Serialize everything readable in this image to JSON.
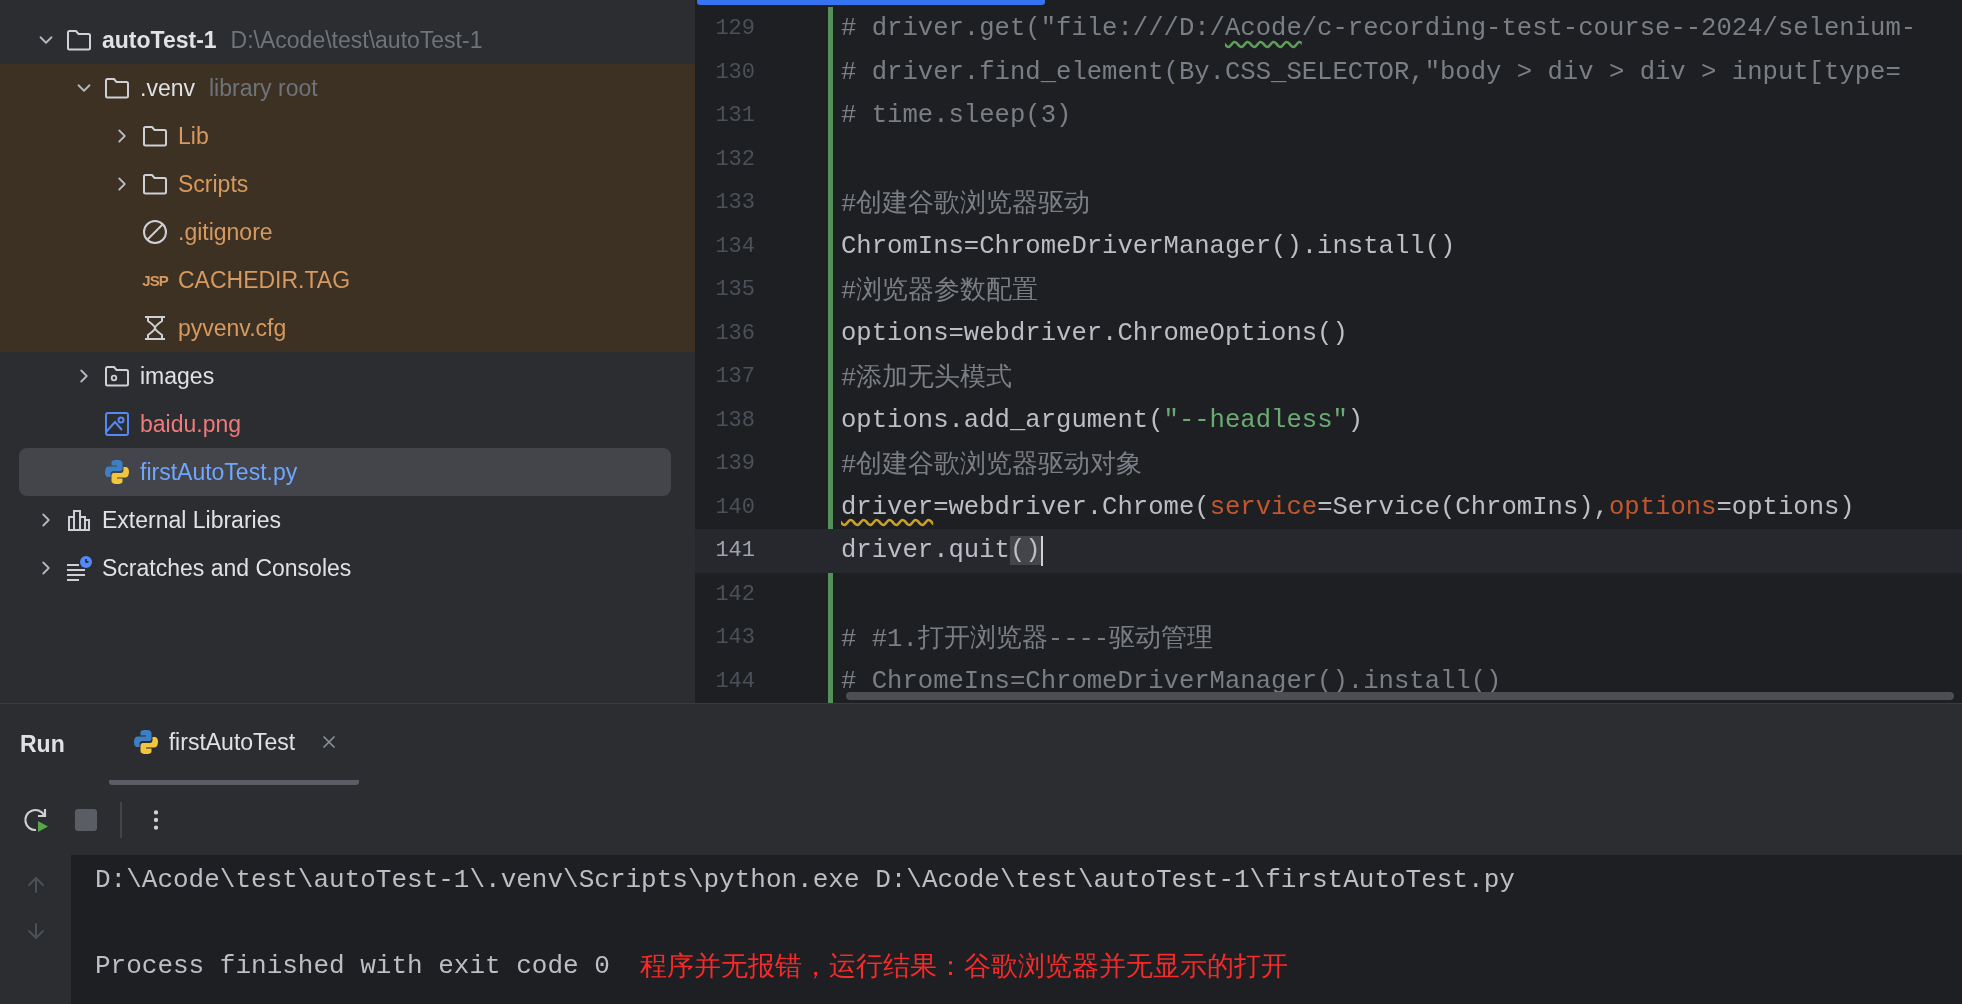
{
  "tree": [
    {
      "name": "autoTest-1",
      "hint": "D:\\Acode\\test\\autoTest-1",
      "kind": "project",
      "expanded": true,
      "selected": false,
      "children": [
        {
          "name": ".venv",
          "hint": "library root",
          "kind": "folder",
          "expanded": true,
          "excluded": true,
          "selected": false,
          "children": [
            {
              "name": "Lib",
              "kind": "folder",
              "expanded": false,
              "selected": false,
              "color": "#d6995f"
            },
            {
              "name": "Scripts",
              "kind": "folder",
              "expanded": false,
              "selected": false,
              "color": "#d6995f"
            },
            {
              "name": ".gitignore",
              "kind": "ignore",
              "selected": false,
              "color": "#d6995f"
            },
            {
              "name": "CACHEDIR.TAG",
              "kind": "tagfile",
              "icon_label": "JSP",
              "selected": false,
              "color": "#d6995f"
            },
            {
              "name": "pyvenv.cfg",
              "kind": "config",
              "selected": false,
              "color": "#d6995f"
            }
          ]
        },
        {
          "name": "images",
          "kind": "resources",
          "expanded": false,
          "selected": false
        },
        {
          "name": "baidu.png",
          "kind": "image",
          "selected": false,
          "color": "#f07a7a"
        },
        {
          "name": "firstAutoTest.py",
          "kind": "python",
          "selected": true,
          "color": "#6fa6ff"
        }
      ]
    },
    {
      "name": "External Libraries",
      "kind": "libraries",
      "expanded": false,
      "selected": false
    },
    {
      "name": "Scratches and Consoles",
      "kind": "scratches",
      "expanded": false,
      "selected": false
    }
  ],
  "editor": {
    "lines": [
      {
        "number": "129",
        "changed": true,
        "current": false,
        "tokens": [
          {
            "kind": "comment",
            "text": "# driver.get(\"file:///D:/"
          },
          {
            "kind": "comment",
            "text": "Acode",
            "typo": true
          },
          {
            "kind": "comment",
            "text": "/c-recording-test-course--2024/selenium-"
          }
        ]
      },
      {
        "number": "130",
        "changed": true,
        "current": false,
        "tokens": [
          {
            "kind": "comment",
            "text": "# driver.find_element(By.CSS_SELECTOR,\"body > div > div > input[type="
          }
        ]
      },
      {
        "number": "131",
        "changed": true,
        "current": false,
        "tokens": [
          {
            "kind": "comment",
            "text": "# time.sleep(3)"
          }
        ]
      },
      {
        "number": "132",
        "changed": true,
        "current": false
      },
      {
        "number": "133",
        "changed": true,
        "current": false,
        "tokens": [
          {
            "kind": "comment",
            "text": "#创建谷歌浏览器驱动"
          }
        ]
      },
      {
        "number": "134",
        "changed": true,
        "current": false,
        "tokens": [
          {
            "kind": "plain",
            "text": "ChromIns=ChromeDriverManager().install()"
          }
        ]
      },
      {
        "number": "135",
        "changed": true,
        "current": false,
        "tokens": [
          {
            "kind": "comment",
            "text": "#浏览器参数配置"
          }
        ]
      },
      {
        "number": "136",
        "changed": true,
        "current": false,
        "tokens": [
          {
            "kind": "plain",
            "text": "options=webdriver.ChromeOptions()"
          }
        ]
      },
      {
        "number": "137",
        "changed": true,
        "current": false,
        "tokens": [
          {
            "kind": "comment",
            "text": "#添加无头模式"
          }
        ]
      },
      {
        "number": "138",
        "changed": true,
        "current": false,
        "tokens": [
          {
            "kind": "plain",
            "text": "options.add_argument("
          },
          {
            "kind": "string",
            "text": "\"--headless\""
          },
          {
            "kind": "plain",
            "text": ")"
          }
        ]
      },
      {
        "number": "139",
        "changed": true,
        "current": false,
        "tokens": [
          {
            "kind": "comment",
            "text": "#创建谷歌浏览器驱动对象"
          }
        ]
      },
      {
        "number": "140",
        "changed": true,
        "current": false,
        "tokens": [
          {
            "kind": "plain",
            "text": "driver",
            "warning": true
          },
          {
            "kind": "plain",
            "text": "=webdriver.Chrome("
          },
          {
            "kind": "param",
            "text": "service"
          },
          {
            "kind": "plain",
            "text": "=Service(ChromIns),"
          },
          {
            "kind": "param",
            "text": "options"
          },
          {
            "kind": "plain",
            "text": "=options)"
          }
        ]
      },
      {
        "number": "141",
        "changed": false,
        "current": true,
        "caret": true,
        "tokens": [
          {
            "kind": "plain",
            "text": "driver.quit"
          },
          {
            "kind": "plain",
            "text": "()",
            "matched": true
          }
        ]
      },
      {
        "number": "142",
        "changed": true,
        "current": false
      },
      {
        "number": "143",
        "changed": true,
        "current": false,
        "tokens": [
          {
            "kind": "comment",
            "text": "# #1.打开浏览器----驱动管理"
          }
        ]
      },
      {
        "number": "144",
        "changed": true,
        "current": false,
        "tokens": [
          {
            "kind": "comment",
            "text": "# ChromeIns=ChromeDriverManager().install()"
          }
        ]
      }
    ]
  },
  "run": {
    "title": "Run",
    "tabs": [
      {
        "label": "firstAutoTest",
        "selected": true
      }
    ],
    "console": [
      {
        "kind": "output",
        "text": "D:\\Acode\\test\\autoTest-1\\.venv\\Scripts\\python.exe D:\\Acode\\test\\autoTest-1\\firstAutoTest.py"
      },
      {
        "kind": "blank"
      },
      {
        "kind": "output",
        "text": "Process finished with exit code 0",
        "note": "程序并无报错，运行结果：谷歌浏览器并无显示的打开"
      }
    ]
  }
}
